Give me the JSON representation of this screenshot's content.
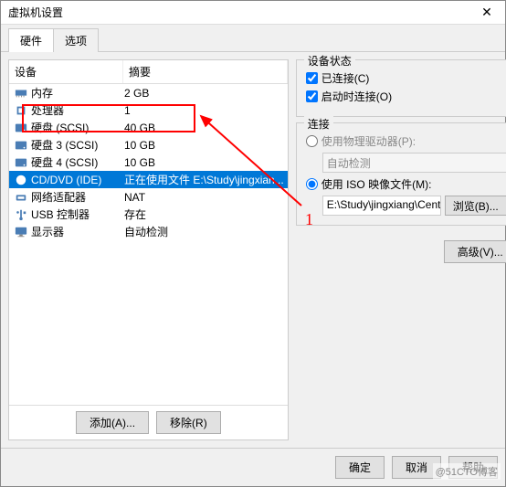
{
  "window": {
    "title": "虚拟机设置"
  },
  "tabs": {
    "hardware": "硬件",
    "options": "选项"
  },
  "columns": {
    "device": "设备",
    "summary": "摘要"
  },
  "devices": [
    {
      "icon": "memory",
      "name": "内存",
      "summary": "2 GB"
    },
    {
      "icon": "cpu",
      "name": "处理器",
      "summary": "1"
    },
    {
      "icon": "disk",
      "name": "硬盘 (SCSI)",
      "summary": "40 GB"
    },
    {
      "icon": "disk",
      "name": "硬盘 3 (SCSI)",
      "summary": "10 GB"
    },
    {
      "icon": "disk",
      "name": "硬盘 4 (SCSI)",
      "summary": "10 GB"
    },
    {
      "icon": "cd",
      "name": "CD/DVD (IDE)",
      "summary": "正在使用文件 E:\\Study\\jingxian...",
      "selected": true
    },
    {
      "icon": "net",
      "name": "网络适配器",
      "summary": "NAT"
    },
    {
      "icon": "usb",
      "name": "USB 控制器",
      "summary": "存在"
    },
    {
      "icon": "display",
      "name": "显示器",
      "summary": "自动检测"
    }
  ],
  "buttons": {
    "add": "添加(A)...",
    "remove": "移除(R)",
    "ok": "确定",
    "cancel": "取消",
    "help": "帮助",
    "browse": "浏览(B)...",
    "advanced": "高级(V)..."
  },
  "right": {
    "status_title": "设备状态",
    "connected": "已连接(C)",
    "connect_at_poweron": "启动时连接(O)",
    "connection_title": "连接",
    "use_physical": "使用物理驱动器(P):",
    "auto_detect": "自动检测",
    "use_iso": "使用 ISO 映像文件(M):",
    "iso_path": "E:\\Study\\jingxiang\\CentOS-..."
  },
  "annotation": {
    "label": "1"
  },
  "watermark": "@51CTO博客"
}
